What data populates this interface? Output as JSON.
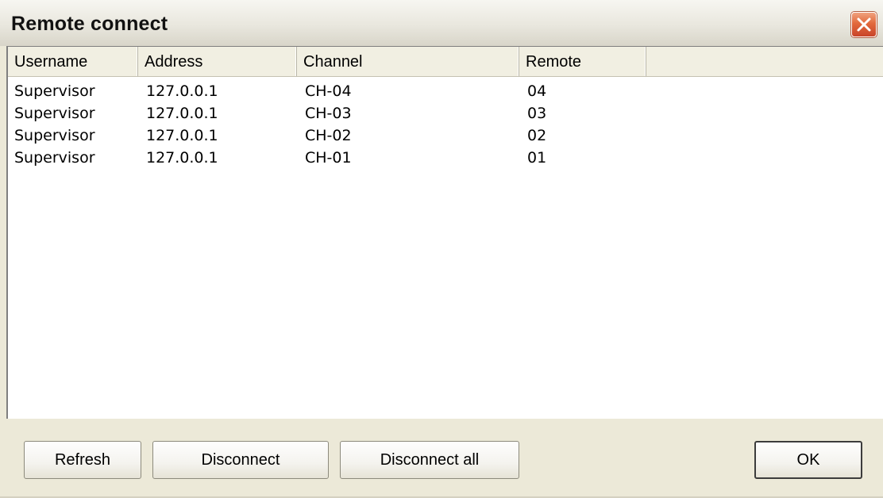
{
  "window": {
    "title": "Remote connect"
  },
  "list": {
    "columns": [
      {
        "label": "Username"
      },
      {
        "label": "Address"
      },
      {
        "label": "Channel"
      },
      {
        "label": "Remote"
      },
      {
        "label": ""
      }
    ],
    "rows": [
      {
        "username": "Supervisor",
        "address": "127.0.0.1",
        "channel": "CH-04",
        "remote": "04"
      },
      {
        "username": "Supervisor",
        "address": "127.0.0.1",
        "channel": "CH-03",
        "remote": "03"
      },
      {
        "username": "Supervisor",
        "address": "127.0.0.1",
        "channel": "CH-02",
        "remote": "02"
      },
      {
        "username": "Supervisor",
        "address": "127.0.0.1",
        "channel": "CH-01",
        "remote": "01"
      }
    ]
  },
  "buttons": {
    "refresh": "Refresh",
    "disconnect": "Disconnect",
    "disconnect_all": "Disconnect all",
    "ok": "OK"
  },
  "icons": {
    "close": "close-icon"
  },
  "colors": {
    "close_button": "#e2693c",
    "dialog_background": "#ece9d8",
    "list_background": "#ffffff"
  }
}
